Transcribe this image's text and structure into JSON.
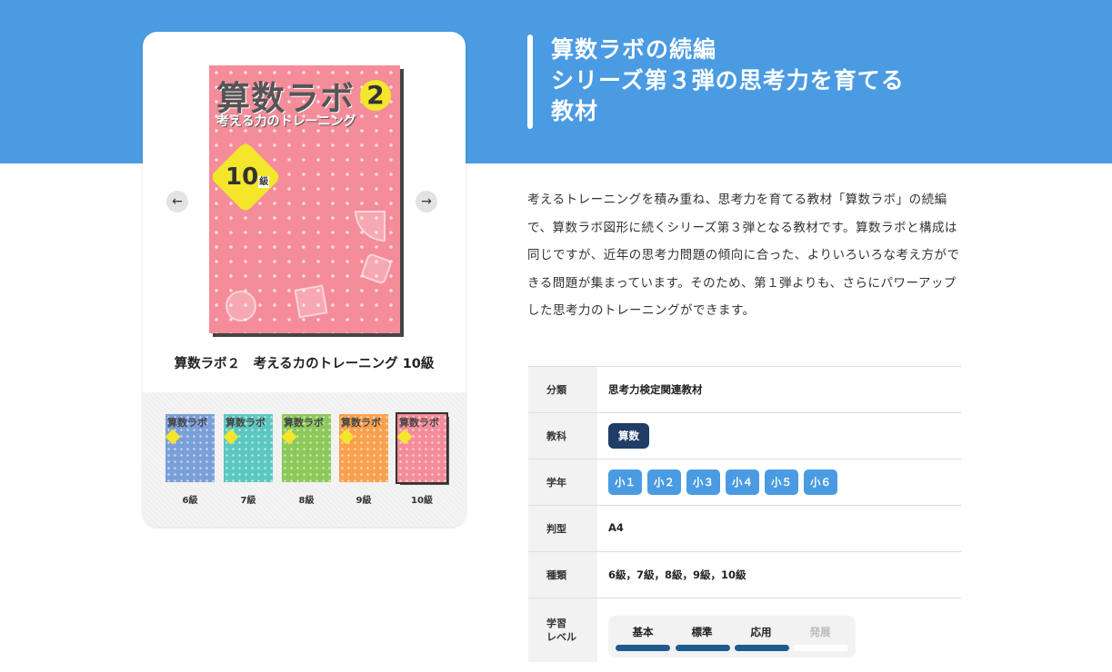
{
  "heading": {
    "lines": [
      "算数ラボの続編",
      "シリーズ第３弾の思考力を育てる",
      "教材"
    ]
  },
  "description": "考えるトレーニングを積み重ね、思考力を育てる教材「算数ラボ」の続編で、算数ラボ図形に続くシリーズ第３弾となる教材です。算数ラボと構成は同じですが、近年の思考力問題の傾向に合った、よりいろいろな考え方ができる問題が集まっています。そのため、第１弾よりも、さらにパワーアップした思考力のトレーニングができます。",
  "product": {
    "title": "算数ラボ２　考えるカのトレーニング 10級",
    "cover": {
      "series": "算数ラボ",
      "volume": "2",
      "subtitle": "考える力のトレーニング",
      "level": "10",
      "level_unit": "級"
    },
    "prev_icon": "arrow-left-icon",
    "next_icon": "arrow-right-icon"
  },
  "thumbnails": [
    {
      "label": "6級",
      "num": "6",
      "color": "#7b9fd8"
    },
    {
      "label": "7級",
      "num": "7",
      "color": "#5cc7c0"
    },
    {
      "label": "8級",
      "num": "8",
      "color": "#8cc95a"
    },
    {
      "label": "9級",
      "num": "9",
      "color": "#f9a14e"
    },
    {
      "label": "10級",
      "num": "10",
      "color": "#f48c9a",
      "selected": true
    }
  ],
  "specs": {
    "category": {
      "label": "分類",
      "value": "思考力検定関連教材"
    },
    "subject": {
      "label": "教科",
      "value": "算数"
    },
    "grade": {
      "label": "学年",
      "values": [
        "小１",
        "小２",
        "小３",
        "小４",
        "小５",
        "小６"
      ]
    },
    "size": {
      "label": "判型",
      "value": "A4"
    },
    "kinds": {
      "label": "種類",
      "value": "6級，7級，8級，9級，10級"
    },
    "level": {
      "label": "学習\nレベル",
      "items": [
        {
          "label": "基本",
          "active": true
        },
        {
          "label": "標準",
          "active": true
        },
        {
          "label": "応用",
          "active": true
        },
        {
          "label": "発展",
          "active": false
        }
      ]
    }
  },
  "colors": {
    "hero": "#4a9be2",
    "navy": "#1f3d66",
    "pill": "#4a9be2",
    "cover": "#f48c9a"
  }
}
